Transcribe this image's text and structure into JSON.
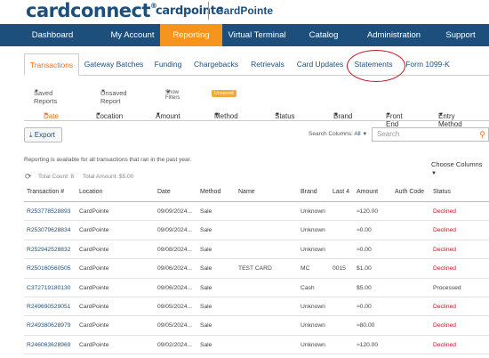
{
  "header": {
    "logo": "cardconnect",
    "sublogo": "cardpointe",
    "merchant": "CardPointe"
  },
  "mainnav": [
    "Dashboard",
    "My Account",
    "Reporting",
    "Virtual Terminal",
    "Catalog",
    "Administration",
    "Support"
  ],
  "subtabs": [
    "Transactions",
    "Gateway Batches",
    "Funding",
    "Chargebacks",
    "Retrievals",
    "Card Updates",
    "Statements",
    "Form 1099-K"
  ],
  "filters": {
    "saved_reports": "Saved Reports",
    "unsaved_report": "Unsaved Report",
    "show_filters": "Show Filters",
    "unsaved_badge": "Unsaved",
    "columns": [
      "Date",
      "Location",
      "Amount",
      "Method",
      "Status",
      "Brand",
      "Front End",
      "Entry Method"
    ]
  },
  "toolbar": {
    "export": "Export",
    "search_columns_label": "Search Columns:",
    "search_columns_value": "All",
    "search_placeholder": "Search",
    "info": "Reporting is available for all transactions that ran in the past year.",
    "choose_columns": "Choose Columns",
    "total_count": "Total Count: 8",
    "total_amount": "Total Amount: $5.00"
  },
  "table": {
    "headers": [
      "Transaction #",
      "Location",
      "Date",
      "Method",
      "Name",
      "Brand",
      "Last 4",
      "Amount",
      "Auth Code",
      "Status"
    ],
    "rows": [
      [
        "R253778528893",
        "CardPointe",
        "09/09/2024...",
        "Sale",
        "",
        "Unknown",
        "",
        "≈120.00",
        "",
        "Declined"
      ],
      [
        "R253079628834",
        "CardPointe",
        "09/09/2024...",
        "Sale",
        "",
        "Unknown",
        "",
        "≈0.00",
        "",
        "Declined"
      ],
      [
        "R252942528832",
        "CardPointe",
        "09/08/2024...",
        "Sale",
        "",
        "Unknown",
        "",
        "≈0.00",
        "",
        "Declined"
      ],
      [
        "R250160560505",
        "CardPointe",
        "09/06/2024...",
        "Sale",
        "TEST CARD",
        "MC",
        "0015",
        "$1.00",
        "",
        "Declined"
      ],
      [
        "C372719180130",
        "CardPointe",
        "09/06/2024...",
        "Sale",
        "",
        "Cash",
        "",
        "$5.00",
        "",
        "Processed"
      ],
      [
        "R249690529051",
        "CardPointe",
        "09/05/2024...",
        "Sale",
        "",
        "Unknown",
        "",
        "≈0.00",
        "",
        "Declined"
      ],
      [
        "R249380628979",
        "CardPointe",
        "09/05/2024...",
        "Sale",
        "",
        "Unknown",
        "",
        "≈80.00",
        "",
        "Declined"
      ],
      [
        "R246063628969",
        "CardPointe",
        "09/02/2024...",
        "Sale",
        "",
        "Unknown",
        "",
        "≈120.00",
        "",
        "Declined"
      ]
    ]
  }
}
